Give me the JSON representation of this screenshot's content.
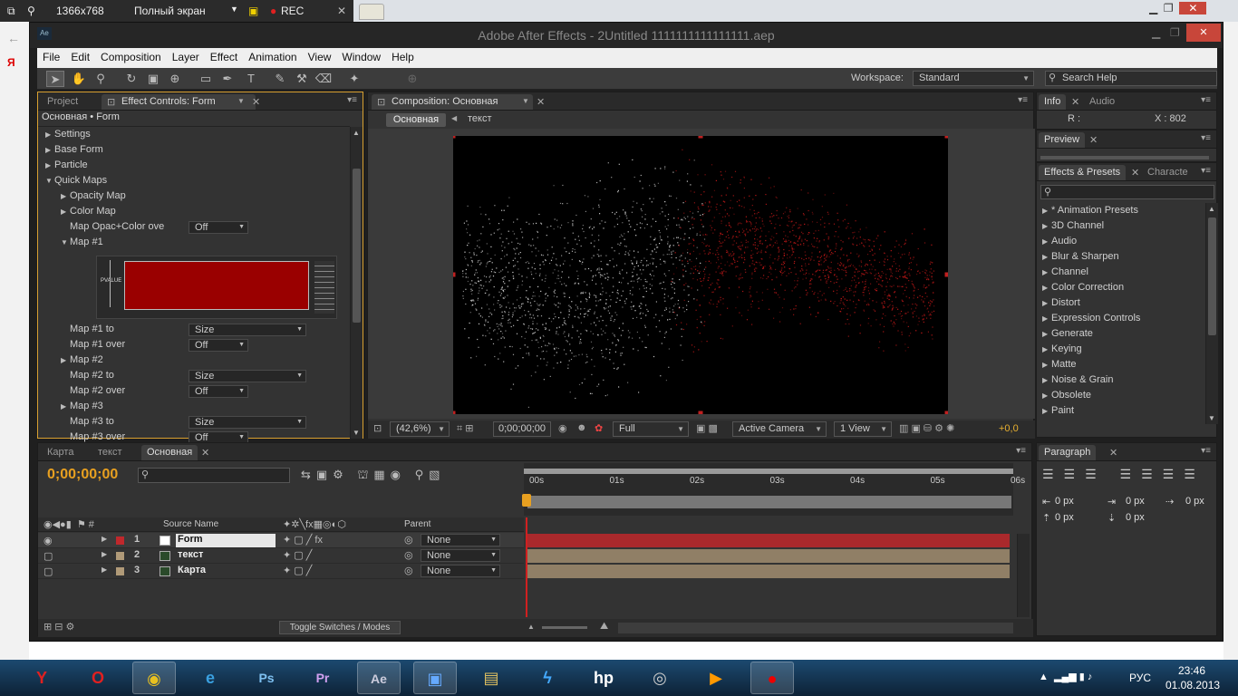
{
  "recorder": {
    "resolution": "1366x768",
    "mode": "Полный экран",
    "rec": "REC"
  },
  "window": {
    "title": "Adobe After Effects - 2Untitled 1111111111111111.aep"
  },
  "menu": [
    "File",
    "Edit",
    "Composition",
    "Layer",
    "Effect",
    "Animation",
    "View",
    "Window",
    "Help"
  ],
  "toolbar": {
    "workspace_label": "Workspace:",
    "workspace_value": "Standard",
    "search_placeholder": "Search Help"
  },
  "left_panel": {
    "tabs": [
      "Project",
      "Effect Controls: Form"
    ],
    "breadcrumb": "Основная • Form",
    "rows": [
      {
        "indent": 1,
        "tri": "▶",
        "label": "Settings"
      },
      {
        "indent": 1,
        "tri": "▶",
        "label": "Base Form"
      },
      {
        "indent": 1,
        "tri": "▶",
        "label": "Particle"
      },
      {
        "indent": 1,
        "tri": "▼",
        "label": "Quick Maps"
      },
      {
        "indent": 2,
        "tri": "▶",
        "label": "Opacity Map"
      },
      {
        "indent": 2,
        "tri": "▶",
        "label": "Color Map"
      },
      {
        "indent": 2,
        "tri": "",
        "label": "Map Opac+Color ove",
        "value": "Off"
      },
      {
        "indent": 2,
        "tri": "▼",
        "label": "Map #1"
      }
    ],
    "map_label": "PVALUE",
    "rows2": [
      {
        "indent": 2,
        "tri": "",
        "label": "Map #1 to",
        "value": "Size",
        "wide": true
      },
      {
        "indent": 2,
        "tri": "",
        "label": "Map #1 over",
        "value": "Off"
      },
      {
        "indent": 2,
        "tri": "▶",
        "label": "Map #2"
      },
      {
        "indent": 2,
        "tri": "",
        "label": "Map #2 to",
        "value": "Size",
        "wide": true
      },
      {
        "indent": 2,
        "tri": "",
        "label": "Map #2 over",
        "value": "Off"
      },
      {
        "indent": 2,
        "tri": "▶",
        "label": "Map #3"
      },
      {
        "indent": 2,
        "tri": "",
        "label": "Map #3 to",
        "value": "Size",
        "wide": true
      },
      {
        "indent": 2,
        "tri": "",
        "label": "Map #3 over",
        "value": "Off"
      }
    ]
  },
  "comp_panel": {
    "tab": "Composition: Основная",
    "crumbs": [
      "Основная",
      "текст"
    ],
    "zoom": "(42,6%)",
    "timecode": "0;00;00;00",
    "resolution": "Full",
    "camera": "Active Camera",
    "views": "1 View",
    "exposure": "+0,0"
  },
  "right_panel": {
    "info_tabs": [
      "Info",
      "Audio"
    ],
    "info_r": "R :",
    "info_x": "X : 802",
    "preview_tab": "Preview",
    "fx_tabs": [
      "Effects & Presets",
      "Characte"
    ],
    "fx_items": [
      "* Animation Presets",
      "3D Channel",
      "Audio",
      "Blur & Sharpen",
      "Channel",
      "Color Correction",
      "Distort",
      "Expression Controls",
      "Generate",
      "Keying",
      "Matte",
      "Noise & Grain",
      "Obsolete",
      "Paint"
    ],
    "paragraph_tab": "Paragraph",
    "para_values": [
      "0 px",
      "0 px",
      "0 px",
      "0 px",
      "0 px"
    ]
  },
  "timeline": {
    "tabs": [
      "Карта",
      "текст",
      "Основная"
    ],
    "timecode": "0;00;00;00",
    "headers": {
      "source": "Source Name",
      "parent": "Parent"
    },
    "ticks": [
      "00s",
      "01s",
      "02s",
      "03s",
      "04s",
      "05s",
      "06s"
    ],
    "layers": [
      {
        "num": "1",
        "name": "Form",
        "parent": "None",
        "color": "#c0282c"
      },
      {
        "num": "2",
        "name": "текст",
        "parent": "None",
        "color": "#b09a78"
      },
      {
        "num": "3",
        "name": "Карта",
        "parent": "None",
        "color": "#b09a78"
      }
    ],
    "toggle_label": "Toggle Switches / Modes"
  },
  "taskbar": {
    "lang": "РУС",
    "time": "23:46",
    "date": "01.08.2013"
  }
}
